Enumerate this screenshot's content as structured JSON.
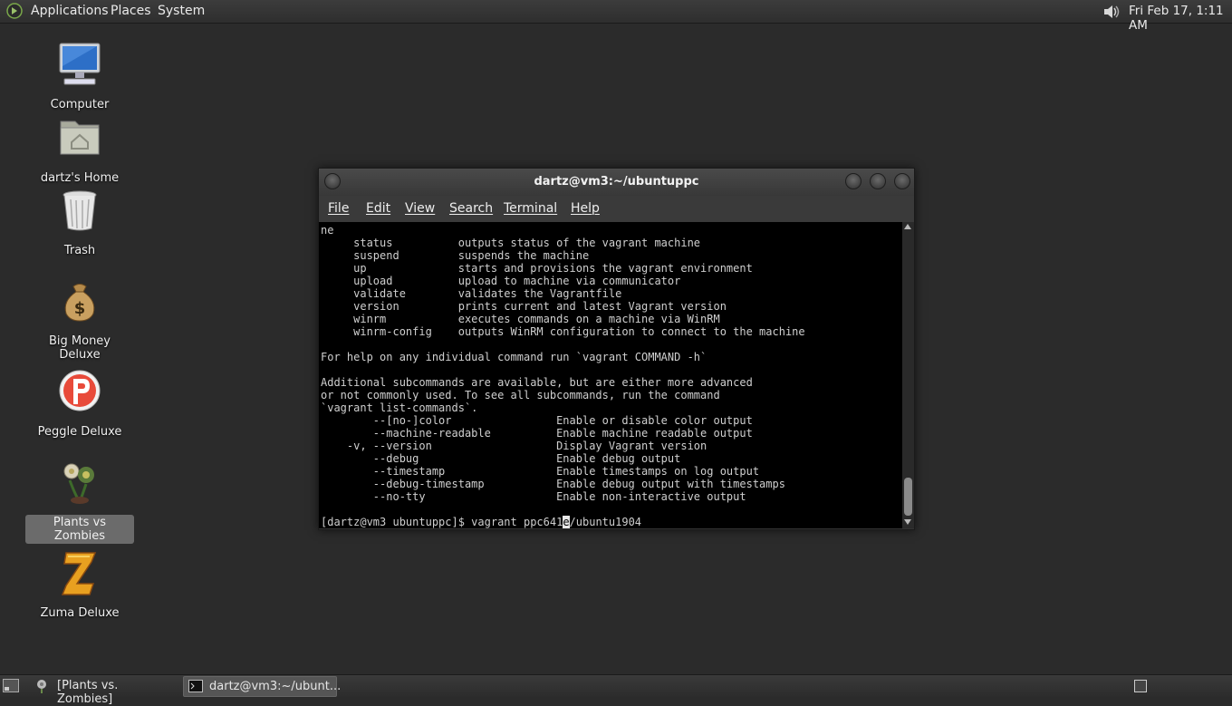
{
  "top_panel": {
    "applications": "Applications",
    "places": "Places",
    "system": "System",
    "clock": "Fri Feb 17, 1:11 AM"
  },
  "desktop_icons": [
    {
      "label": "Computer",
      "icon": "computer-icon"
    },
    {
      "label": "dartz's Home",
      "icon": "home-folder-icon"
    },
    {
      "label": "Trash",
      "icon": "trash-icon"
    },
    {
      "label": "Big Money Deluxe",
      "icon": "money-bag-icon"
    },
    {
      "label": "Peggle Deluxe",
      "icon": "peggle-icon"
    },
    {
      "label": "Plants vs Zombies",
      "icon": "plants-vs-zombies-icon",
      "selected": true
    },
    {
      "label": "Zuma Deluxe",
      "icon": "zuma-icon"
    }
  ],
  "terminal": {
    "title": "dartz@vm3:~/ubuntuppc",
    "menu": [
      "File",
      "Edit",
      "View",
      "Search",
      "Terminal",
      "Help"
    ],
    "lines": [
      "ne",
      "     status          outputs status of the vagrant machine",
      "     suspend         suspends the machine",
      "     up              starts and provisions the vagrant environment",
      "     upload          upload to machine via communicator",
      "     validate        validates the Vagrantfile",
      "     version         prints current and latest Vagrant version",
      "     winrm           executes commands on a machine via WinRM",
      "     winrm-config    outputs WinRM configuration to connect to the machine",
      "",
      "For help on any individual command run `vagrant COMMAND -h`",
      "",
      "Additional subcommands are available, but are either more advanced",
      "or not commonly used. To see all subcommands, run the command",
      "`vagrant list-commands`.",
      "        --[no-]color                Enable or disable color output",
      "        --machine-readable          Enable machine readable output",
      "    -v, --version                   Display Vagrant version",
      "        --debug                     Enable debug output",
      "        --timestamp                 Enable timestamps on log output",
      "        --debug-timestamp           Enable debug output with timestamps",
      "        --no-tty                    Enable non-interactive output",
      ""
    ],
    "prompt_before_cursor": "[dartz@vm3 ubuntuppc]$ vagrant ppc641",
    "cursor_char": "e",
    "prompt_after_cursor": "/ubuntu1904"
  },
  "taskbar": {
    "tasks": [
      {
        "label": "[Plants vs. Zombies]",
        "icon": "plants-vs-zombies-icon"
      },
      {
        "label": "dartz@vm3:~/ubunt...",
        "icon": "terminal-icon"
      }
    ]
  },
  "colors": {
    "desktop": "#2b2b2b",
    "terminal_bg": "#000000",
    "terminal_fg": "#cfcfcf"
  }
}
